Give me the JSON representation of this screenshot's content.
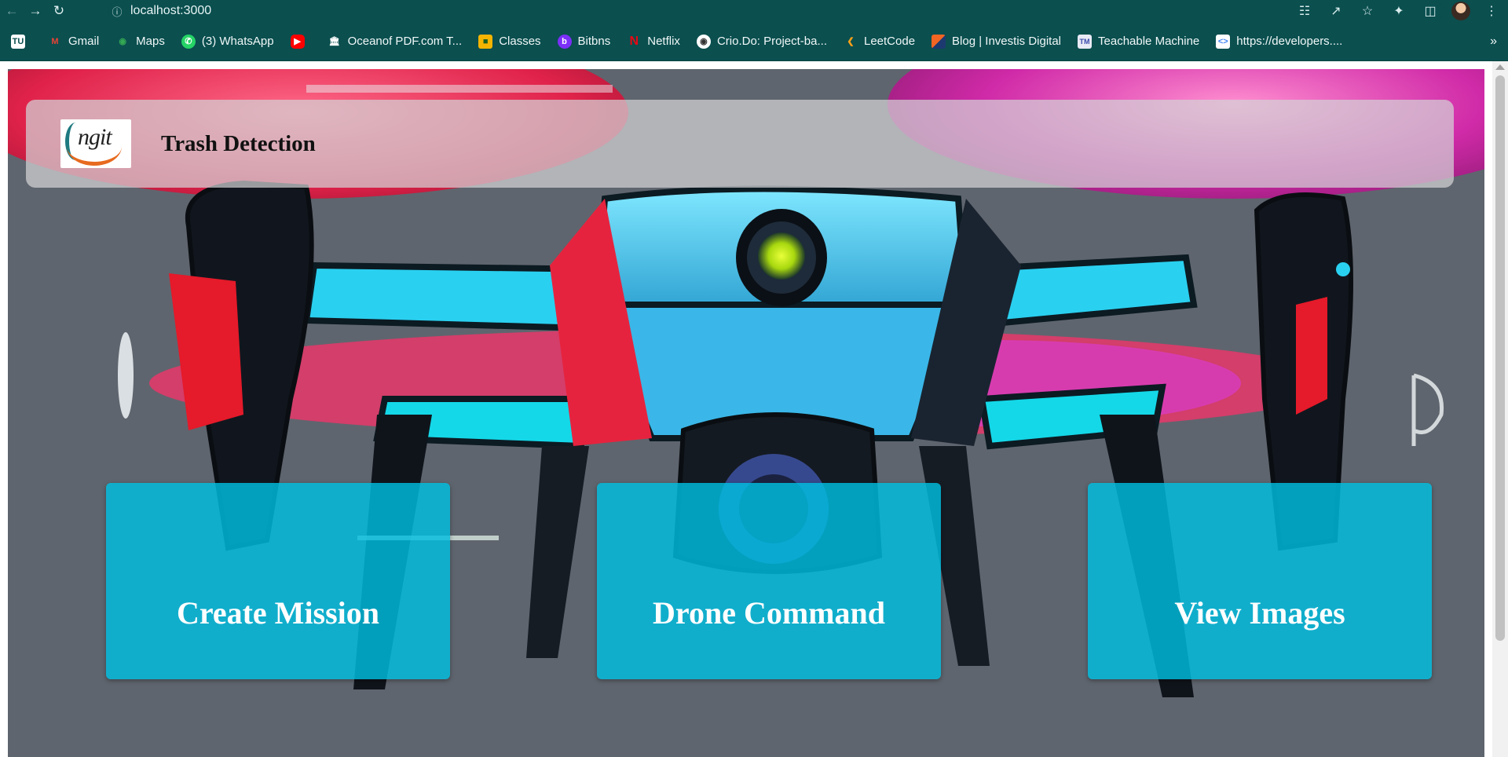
{
  "browser": {
    "url": "localhost:3000",
    "bookmarks": [
      {
        "label": "",
        "icon": "tu-icon",
        "color": "#ffffff"
      },
      {
        "label": "Gmail",
        "icon": "gmail-icon",
        "color": "#ea4335"
      },
      {
        "label": "Maps",
        "icon": "maps-icon",
        "color": "#34a853"
      },
      {
        "label": "(3) WhatsApp",
        "icon": "whatsapp-icon",
        "color": "#25d366"
      },
      {
        "label": "",
        "icon": "youtube-icon",
        "color": "#ff0000"
      },
      {
        "label": "Oceanof PDF.com T...",
        "icon": "pdf-library-icon",
        "color": "#ffffff"
      },
      {
        "label": "Classes",
        "icon": "classroom-icon",
        "color": "#f4b400"
      },
      {
        "label": "Bitbns",
        "icon": "bitbns-icon",
        "color": "#7b2ff7"
      },
      {
        "label": "Netflix",
        "icon": "netflix-icon",
        "color": "#e50914"
      },
      {
        "label": "Crio.Do: Project-ba...",
        "icon": "crio-icon",
        "color": "#ffffff"
      },
      {
        "label": "LeetCode",
        "icon": "leetcode-icon",
        "color": "#ffa116"
      },
      {
        "label": "Blog | Investis Digital",
        "icon": "investis-icon",
        "color": "#f26522"
      },
      {
        "label": "Teachable Machine",
        "icon": "teachable-machine-icon",
        "color": "#4285f4"
      },
      {
        "label": "https://developers....",
        "icon": "developers-icon",
        "color": "#ffffff"
      }
    ],
    "more_label": "»"
  },
  "header": {
    "logo_text": "ngit",
    "title": "Trash Detection"
  },
  "actions": {
    "create_mission": "Create Mission",
    "drone_command": "Drone Command",
    "view_images": "View Images"
  },
  "colors": {
    "chrome": "#0b4f4f",
    "card": "#00bee1",
    "header_panel": "#d2d2d6"
  }
}
